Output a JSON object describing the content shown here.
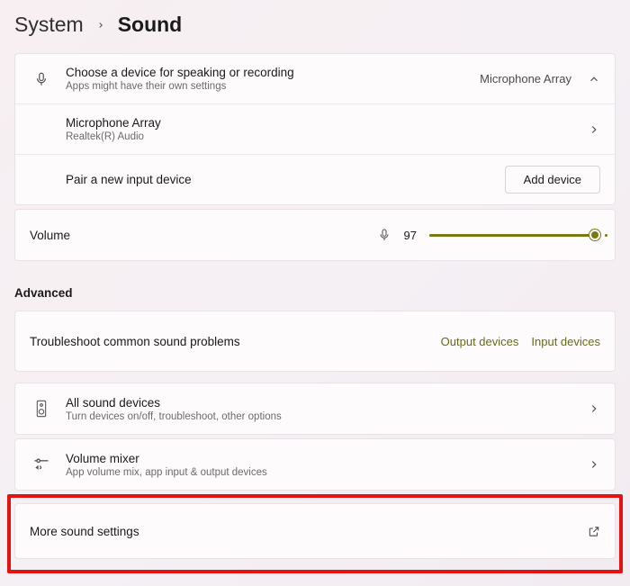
{
  "breadcrumb": {
    "parent": "System",
    "current": "Sound"
  },
  "input_section": {
    "choose": {
      "title": "Choose a device for speaking or recording",
      "sub": "Apps might have their own settings",
      "selected": "Microphone Array"
    },
    "device": {
      "title": "Microphone Array",
      "sub": "Realtek(R) Audio"
    },
    "pair": {
      "title": "Pair a new input device",
      "button": "Add device"
    }
  },
  "volume": {
    "label": "Volume",
    "value": "97"
  },
  "advanced_header": "Advanced",
  "troubleshoot": {
    "title": "Troubleshoot common sound problems",
    "output": "Output devices",
    "input": "Input devices"
  },
  "all_devices": {
    "title": "All sound devices",
    "sub": "Turn devices on/off, troubleshoot, other options"
  },
  "mixer": {
    "title": "Volume mixer",
    "sub": "App volume mix, app input & output devices"
  },
  "more": {
    "title": "More sound settings"
  }
}
